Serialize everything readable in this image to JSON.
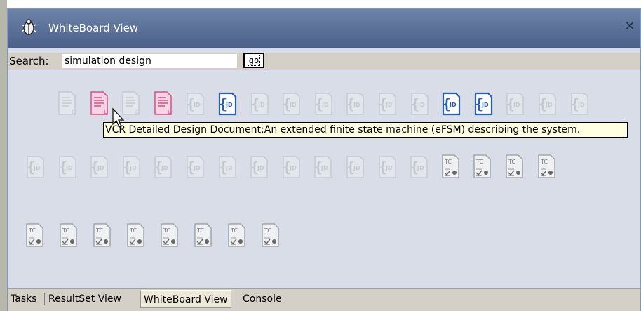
{
  "window": {
    "title": "WhiteBoard View",
    "close_glyph": "×"
  },
  "search": {
    "label": "Search:",
    "value": "simulation design",
    "go_label": "go"
  },
  "artifacts": [
    {
      "kind": "doc",
      "state": "faded"
    },
    {
      "kind": "doc",
      "state": "pink"
    },
    {
      "kind": "doc",
      "state": "faded"
    },
    {
      "kind": "doc",
      "state": "pink"
    },
    {
      "kind": "jd",
      "state": "faded"
    },
    {
      "kind": "jd",
      "state": "blue"
    },
    {
      "kind": "jd",
      "state": "faded"
    },
    {
      "kind": "jd",
      "state": "faded"
    },
    {
      "kind": "jd",
      "state": "faded"
    },
    {
      "kind": "jd",
      "state": "faded"
    },
    {
      "kind": "jd",
      "state": "faded"
    },
    {
      "kind": "jd",
      "state": "faded"
    },
    {
      "kind": "jd",
      "state": "blue"
    },
    {
      "kind": "jd",
      "state": "blue"
    },
    {
      "kind": "jd",
      "state": "faded"
    },
    {
      "kind": "jd",
      "state": "faded"
    },
    {
      "kind": "jd",
      "state": "faded"
    },
    {
      "kind": "jd",
      "state": "faded"
    },
    {
      "kind": "jd",
      "state": "faded"
    },
    {
      "kind": "jd",
      "state": "faded"
    },
    {
      "kind": "jd",
      "state": "faded"
    },
    {
      "kind": "jd",
      "state": "faded"
    },
    {
      "kind": "jd",
      "state": "faded"
    },
    {
      "kind": "jd",
      "state": "faded"
    },
    {
      "kind": "jd",
      "state": "faded"
    },
    {
      "kind": "jd",
      "state": "faded"
    },
    {
      "kind": "jd",
      "state": "faded"
    },
    {
      "kind": "jd",
      "state": "faded"
    },
    {
      "kind": "jd",
      "state": "faded"
    },
    {
      "kind": "jd",
      "state": "faded"
    },
    {
      "kind": "tc",
      "state": "normal"
    },
    {
      "kind": "tc",
      "state": "normal"
    },
    {
      "kind": "tc",
      "state": "normal"
    },
    {
      "kind": "tc",
      "state": "normal"
    },
    {
      "kind": "tc",
      "state": "normal"
    },
    {
      "kind": "tc",
      "state": "normal"
    },
    {
      "kind": "tc",
      "state": "normal"
    },
    {
      "kind": "tc",
      "state": "normal"
    },
    {
      "kind": "tc",
      "state": "normal"
    },
    {
      "kind": "tc",
      "state": "normal"
    },
    {
      "kind": "tc",
      "state": "normal"
    },
    {
      "kind": "tc",
      "state": "normal"
    }
  ],
  "icon_text": {
    "doc": "D",
    "jd": "JD",
    "tc": "TC"
  },
  "tooltip": "VCR Detailed Design Document:An extended finite state machine (eFSM) describing the system.",
  "tabs": [
    {
      "label": "Tasks",
      "active": false
    },
    {
      "label": "ResultSet View",
      "active": false
    },
    {
      "label": "WhiteBoard View",
      "active": true
    },
    {
      "label": "Console",
      "active": false
    }
  ],
  "colors": {
    "title_bar": "#5a6f97",
    "panel_bg": "#d8dde7",
    "faded_icon": "#c4c8d2",
    "pink_icon": "#d94f8a",
    "blue_icon": "#2b5fa8",
    "tc_icon": "#9a9a9a",
    "tooltip_bg": "#ffffe1"
  },
  "icons": {
    "title": "eclipse-bug-icon",
    "cursor": "mouse-pointer-icon"
  }
}
